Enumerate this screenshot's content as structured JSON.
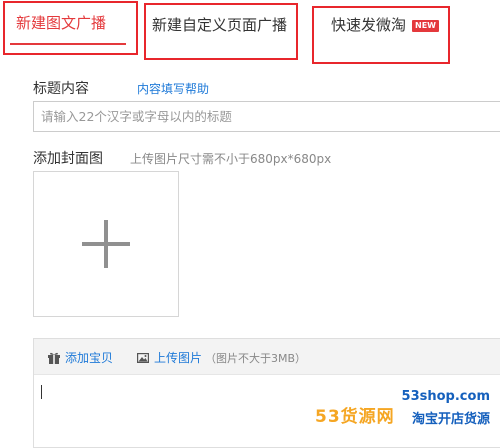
{
  "tabs": [
    {
      "label": "新建图文广播",
      "active": true
    },
    {
      "label": "新建自定义页面广播",
      "active": false
    },
    {
      "label": "快速发微淘",
      "active": false,
      "badge": "NEW"
    }
  ],
  "form": {
    "title_label": "标题内容",
    "help_link": "内容填写帮助",
    "title_placeholder": "请输入22个汉字或字母以内的标题",
    "cover_label": "添加封面图",
    "cover_hint": "上传图片尺寸需不小于680px*680px",
    "upload_icon": "plus-icon"
  },
  "editor": {
    "add_item_label": "添加宝贝",
    "add_item_icon": "gift-icon",
    "upload_image_label": "上传图片",
    "upload_image_icon": "image-icon",
    "upload_image_note": "（图片不大于3MB）"
  },
  "watermark": {
    "site": "53shop.com",
    "brand": "53货源网",
    "slogan": "淘宝开店货源"
  },
  "colors": {
    "accent": "#e4393c",
    "link": "#1f7ad8",
    "highlight": "#e8262c"
  }
}
